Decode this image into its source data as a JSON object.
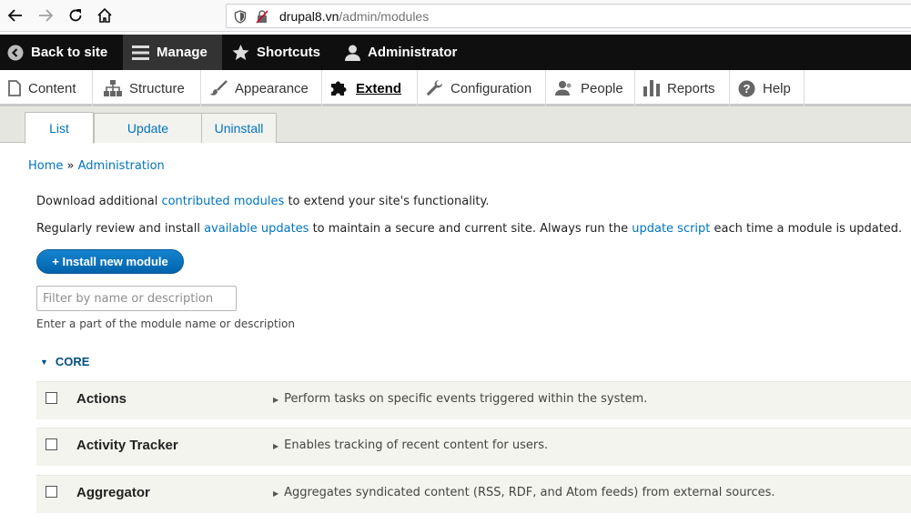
{
  "browser": {
    "url_host": "drupal8.vn",
    "url_path": "/admin/modules"
  },
  "toolbar": {
    "items": [
      {
        "label": "Back to site",
        "icon": "back-circle-icon"
      },
      {
        "label": "Manage",
        "icon": "menu-icon"
      },
      {
        "label": "Shortcuts",
        "icon": "star-icon"
      },
      {
        "label": "Administrator",
        "icon": "person-icon"
      }
    ]
  },
  "tray": {
    "items": [
      {
        "label": "Content",
        "icon": "document-icon"
      },
      {
        "label": "Structure",
        "icon": "structure-icon"
      },
      {
        "label": "Appearance",
        "icon": "brush-icon"
      },
      {
        "label": "Extend",
        "icon": "puzzle-icon"
      },
      {
        "label": "Configuration",
        "icon": "wrench-icon"
      },
      {
        "label": "People",
        "icon": "people-icon"
      },
      {
        "label": "Reports",
        "icon": "bar-chart-icon"
      },
      {
        "label": "Help",
        "icon": "help-icon"
      }
    ]
  },
  "tabs": [
    "List",
    "Update",
    "Uninstall"
  ],
  "breadcrumb": {
    "home": "Home",
    "sep": "»",
    "current": "Administration"
  },
  "intro": {
    "p1_before": "Download additional ",
    "p1_link": "contributed modules",
    "p1_after": " to extend your site's functionality.",
    "p2_before": "Regularly review and install ",
    "p2_link1": "available updates",
    "p2_mid": " to maintain a secure and current site. Always run the ",
    "p2_link2": "update script",
    "p2_after": " each time a module is updated."
  },
  "install_button": "+ Install new module",
  "filter": {
    "placeholder": "Filter by name or description",
    "description": "Enter a part of the module name or description"
  },
  "core_label": "CORE",
  "modules": [
    {
      "name": "Actions",
      "description": "Perform tasks on specific events triggered within the system."
    },
    {
      "name": "Activity Tracker",
      "description": "Enables tracking of recent content for users."
    },
    {
      "name": "Aggregator",
      "description": "Aggregates syndicated content (RSS, RDF, and Atom feeds) from external sources."
    }
  ]
}
